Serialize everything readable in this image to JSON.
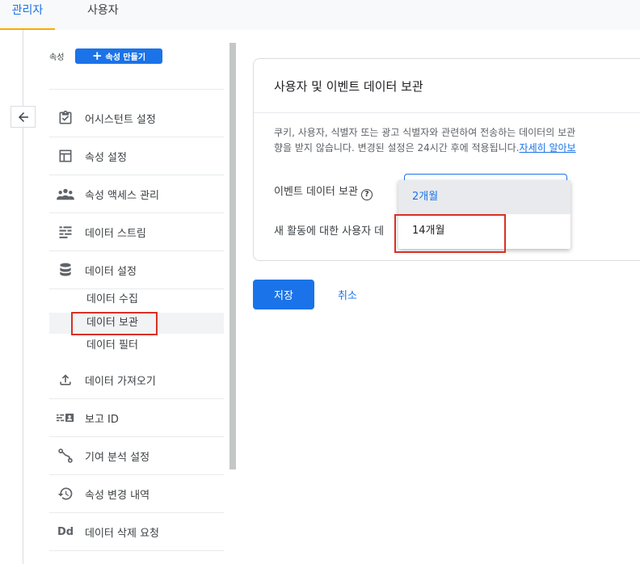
{
  "tabs": {
    "admin": "관리자",
    "user": "사용자"
  },
  "property": {
    "label": "속성",
    "create_button": "속성 만들기"
  },
  "nav": {
    "assistant": "어시스턴트 설정",
    "property_settings": "속성 설정",
    "access_management": "속성 액세스 관리",
    "data_streams": "데이터 스트림",
    "data_settings": "데이터 설정",
    "data_collection": "데이터 수집",
    "data_retention": "데이터 보관",
    "data_filters": "데이터 필터",
    "data_import": "데이터 가져오기",
    "reporting_id": "보고 ID",
    "attribution_settings": "기여 분석 설정",
    "change_history": "속성 변경 내역",
    "data_deletion": "데이터 삭제 요청",
    "data_deletion_icon_text": "Dd"
  },
  "card": {
    "title": "사용자 및 이벤트 데이터 보관",
    "description_line1": "쿠키, 사용자, 식별자 또는 광고 식별자와 관련하여 전송하는 데이터의 보관",
    "description_line2": "향을 받지 않습니다. 변경된 설정은 24시간 후에 적용됩니다.",
    "learn_more": "자세히 알아보",
    "event_retention_label": "이벤트 데이터 보관",
    "reset_label": "새 활동에 대한 사용자 데"
  },
  "dropdown": {
    "options": [
      "2개월",
      "14개월"
    ],
    "selected": "2개월"
  },
  "actions": {
    "save": "저장",
    "cancel": "취소"
  },
  "colors": {
    "accent": "#1a73e8",
    "highlight": "#d93025",
    "tab_indicator": "#f9ab00"
  }
}
